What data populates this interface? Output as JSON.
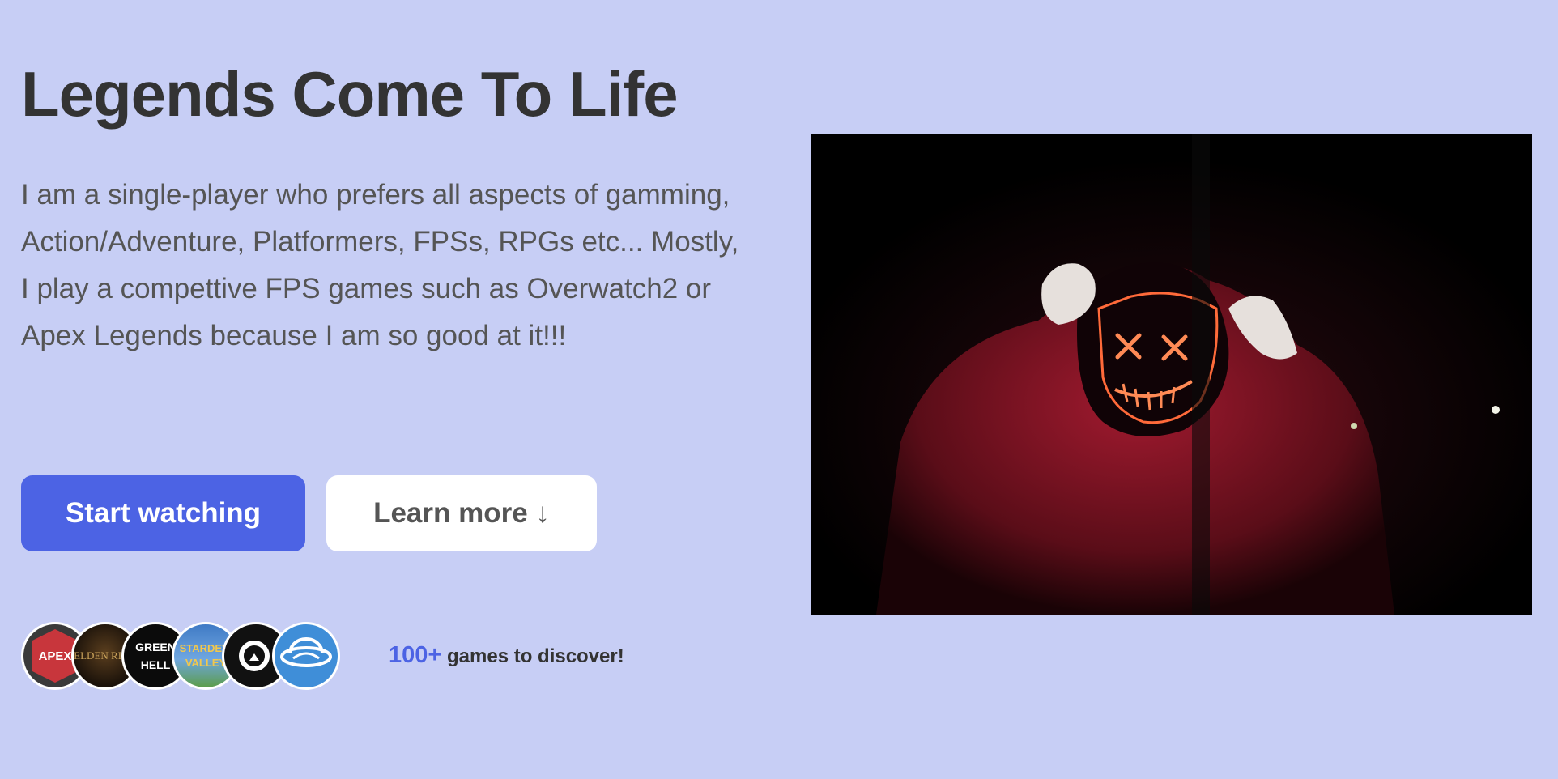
{
  "hero": {
    "title": "Legends Come To Life",
    "description": "I am a single-player who prefers all aspects of gamming, Action/Adventure, Platformers, FPSs, RPGs etc... Mostly, I play a compettive FPS games such as Overwatch2 or Apex Legends because I am so good at it!!!",
    "primary_button": "Start watching",
    "secondary_button": "Learn more ↓"
  },
  "games": {
    "avatars": [
      {
        "icon": "apex-legends-logo",
        "text": "APEX"
      },
      {
        "icon": "elden-ring-logo",
        "text": "ELDEN RING"
      },
      {
        "icon": "green-hell-logo",
        "text": "GREEN HELL"
      },
      {
        "icon": "stardew-valley-logo",
        "text": "STARDEW VALLEY"
      },
      {
        "icon": "overwatch-2-logo",
        "text": "2"
      },
      {
        "icon": "planet-coaster-logo",
        "text": ""
      }
    ],
    "count": "100+",
    "label": " games to discover!"
  },
  "colors": {
    "background": "#c7cef5",
    "accent": "#4c63e4",
    "heading": "#333333",
    "body_text": "#555555"
  },
  "image": {
    "icon": "hooded-figure-neon-mask-photo"
  }
}
